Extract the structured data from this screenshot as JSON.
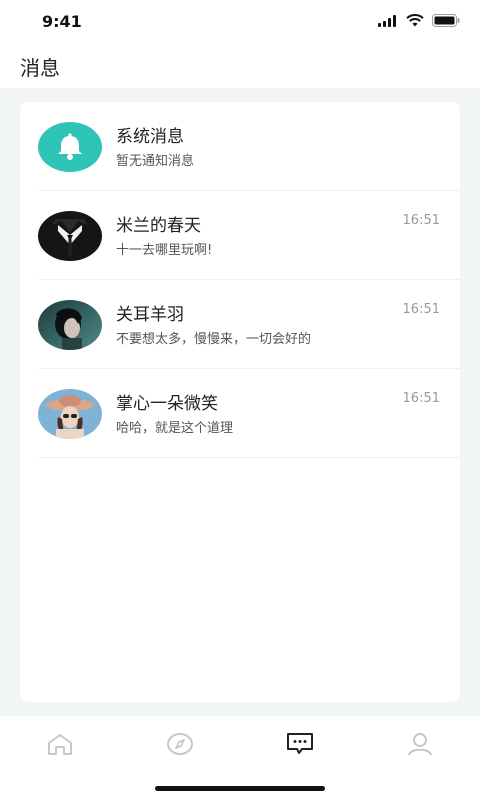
{
  "status": {
    "time": "9:41"
  },
  "header": {
    "title": "消息"
  },
  "messages": [
    {
      "name": "系统消息",
      "preview": "暂无通知消息",
      "time": "",
      "avatar": "bell-icon"
    },
    {
      "name": "米兰的春天",
      "preview": "十一去哪里玩啊!",
      "time": "16:51",
      "avatar": "avatar-suit"
    },
    {
      "name": "关耳羊羽",
      "preview": "不要想太多，慢慢来，一切会好的",
      "time": "16:51",
      "avatar": "avatar-portrait"
    },
    {
      "name": "掌心一朵微笑",
      "preview": "哈哈，就是这个道理",
      "time": "16:51",
      "avatar": "avatar-hat"
    }
  ],
  "tabbar": {
    "items": [
      {
        "icon": "home-icon",
        "active": false
      },
      {
        "icon": "compass-icon",
        "active": false
      },
      {
        "icon": "chat-icon",
        "active": true
      },
      {
        "icon": "profile-icon",
        "active": false
      }
    ]
  },
  "colors": {
    "accent": "#2ec4b6",
    "active_tab": "#222222",
    "inactive_tab": "#c8c8c8"
  }
}
